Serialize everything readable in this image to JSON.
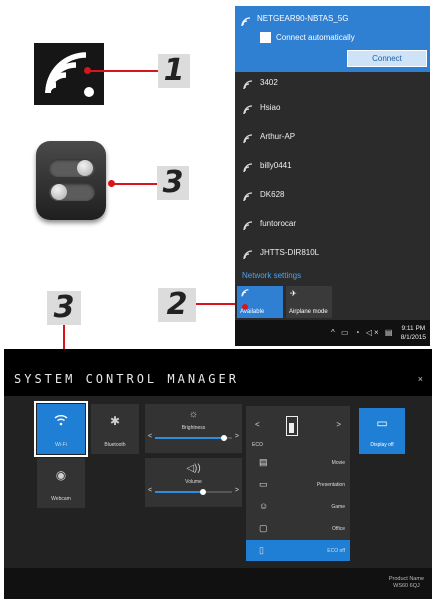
{
  "callouts": {
    "wifi_number": "1",
    "toggle_number": "3",
    "manager_number": "3",
    "flyout_number": "2"
  },
  "flyout": {
    "connected_ssid": "NETGEAR90-NBTAS_5G",
    "connect_auto_label": "Connect automatically",
    "connect_button": "Connect",
    "networks": [
      "3402",
      "Hsiao",
      "Arthur-AP",
      "billy0441",
      "DK628",
      "funtorocar",
      "JHTTS-DIR810L"
    ],
    "settings_link": "Network settings",
    "quick_wifi_label": "Available",
    "quick_airplane_label": "Airplane mode",
    "time": "9:11 PM",
    "date": "8/1/2015"
  },
  "scm": {
    "title": "SYSTEM CONTROL MANAGER",
    "close": "×",
    "wifi_label": "Wi-Fi",
    "bluetooth_label": "Bluetooth",
    "webcam_label": "Webcam",
    "brightness_label": "Brightness",
    "brightness_level": 0.9,
    "volume_label": "Volume",
    "volume_level": 0.62,
    "eco_label": "ECO",
    "eco_modes": [
      "Movie",
      "Presentation",
      "Game",
      "Office",
      "ECO off"
    ],
    "eco_selected": "ECO off",
    "display_off_label": "Display off",
    "product_name_label": "Product Name",
    "product_name_value": "WS60 6QJ"
  },
  "colors": {
    "accent_blue": "#1e7fd4",
    "callout_red": "#d8141c",
    "flyout_blue": "#2f7fd3"
  }
}
